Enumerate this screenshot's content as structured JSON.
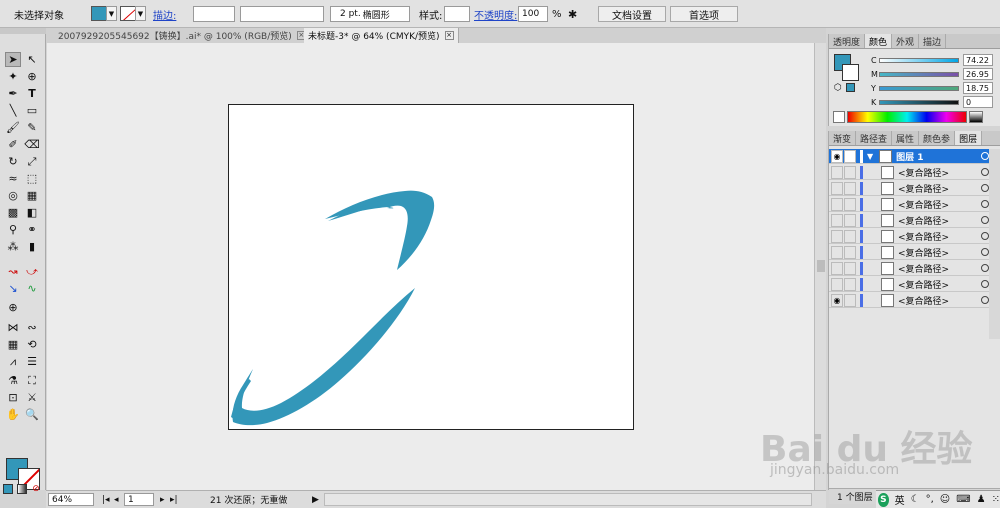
{
  "control_bar": {
    "selection_status": "未选择对象",
    "fill_color": "#3397b9",
    "stroke_label": "描边:",
    "stroke_weight": "",
    "brush_size": "2 pt.",
    "brush_shape": "椭圆形",
    "style_label": "样式:",
    "opacity_label": "不透明度:",
    "opacity_value": "100",
    "opacity_unit": "%",
    "doc_setup_button": "文档设置",
    "preferences_button": "首选项"
  },
  "tabs": [
    {
      "label": "2007929205545692【铸换】.ai* @ 100% (RGB/预览)",
      "active": false
    },
    {
      "label": "未标题-3* @ 64% (CMYK/预览)",
      "active": true
    }
  ],
  "color_panel": {
    "tabs": [
      "透明度",
      "颜色",
      "外观",
      "描边"
    ],
    "active_tab": "颜色",
    "channels": [
      {
        "name": "C",
        "value": "74.22"
      },
      {
        "name": "M",
        "value": "26.95"
      },
      {
        "name": "Y",
        "value": "18.75"
      },
      {
        "name": "K",
        "value": "0"
      }
    ]
  },
  "layers_panel": {
    "tabs": [
      "渐变",
      "路径查",
      "属性",
      "颜色参",
      "图层"
    ],
    "active_tab": "图层",
    "parent_layer": "图层 1",
    "sublayers": [
      "<复合路径>",
      "<复合路径>",
      "<复合路径>",
      "<复合路径>",
      "<复合路径>",
      "<复合路径>",
      "<复合路径>",
      "<复合路径>",
      "<复合路径>"
    ],
    "footer": "1 个图层"
  },
  "status_bar": {
    "zoom": "64%",
    "page": "1",
    "history": "21 次还原；无重做"
  },
  "ime": {
    "lang": "英",
    "logo": "S"
  },
  "watermark": {
    "brand": "Bai du 经验",
    "url": "jingyan.baidu.com"
  },
  "colors": {
    "accent": "#3397b9",
    "selection": "#1f73d8"
  }
}
